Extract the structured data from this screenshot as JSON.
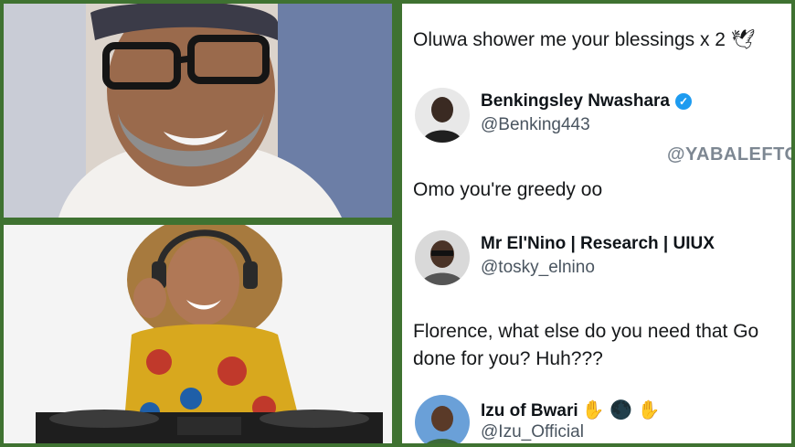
{
  "tweets": [
    {
      "text": "Oluwa shower me your blessings x 2 🕊"
    },
    {
      "text": "Omo you're greedy oo"
    },
    {
      "text_line1": "Florence, what else do you need that Go",
      "text_line2": "done for you? Huh???"
    }
  ],
  "users": [
    {
      "name": "Benkingsley Nwashara",
      "handle": "@Benking443",
      "verified": "✓"
    },
    {
      "name": "Mr El'Nino | Research | UIUX",
      "handle": "@tosky_elnino"
    },
    {
      "name": "Izu of Bwari",
      "name_emojis": "✋ 🌑 ✋",
      "handle": "@Izu_Official"
    }
  ],
  "watermark": "@YABALEFTO",
  "colors": {
    "border": "#3f7231",
    "verified": "#1d9bf0",
    "text": "#16181a",
    "handle": "#4a5560"
  }
}
